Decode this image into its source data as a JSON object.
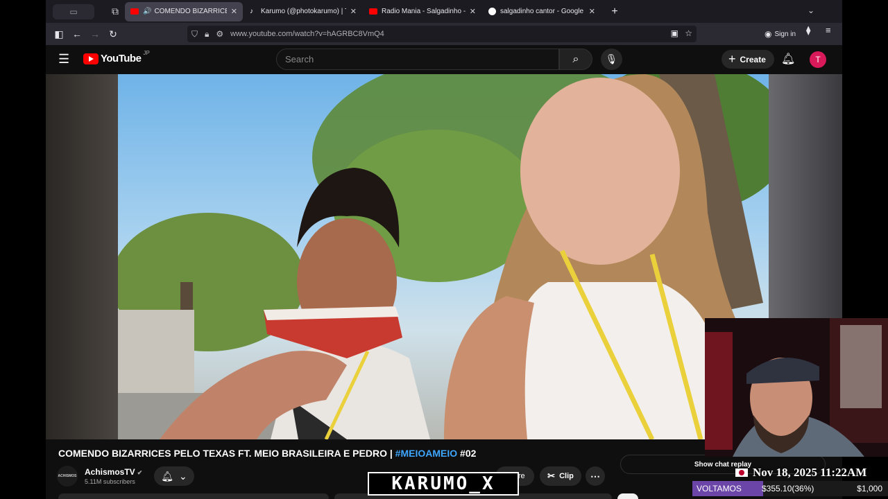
{
  "browser": {
    "tabs": [
      {
        "label": "COMENDO BIZARRICES PELO TEXAS",
        "favicon": "youtube-icon",
        "active": true,
        "audio": true
      },
      {
        "label": "Karumo (@photokarumo) | TikTok",
        "favicon": "tiktok-icon",
        "active": false
      },
      {
        "label": "Radio Mania - Salgadinho - Ainda",
        "favicon": "youtube-icon",
        "active": false
      },
      {
        "label": "salgadinho cantor - Google Search",
        "favicon": "google-icon",
        "active": false
      }
    ],
    "url": "www.youtube.com/watch?v=hAGRBC8VmQ4",
    "signin_label": "Sign in"
  },
  "youtube": {
    "logo_text": "YouTube",
    "region": "JP",
    "search_placeholder": "Search",
    "create_label": "Create",
    "avatar_letter": "T"
  },
  "video": {
    "title_main": "COMENDO BIZARRICES PELO TEXAS FT. MEIO BRASILEIRA E PEDRO | ",
    "title_hashtag": "#MEIOAMEIO",
    "title_suffix": " #02",
    "channel_name": "AchismosTV",
    "channel_avatar_text": "ACHISMOS",
    "subscribers": "5.11M subscribers",
    "share_label": "Share",
    "clip_label": "Clip",
    "chat_replay_label": "Show chat replay"
  },
  "overlay": {
    "datetime": "Nov 18, 2025 11:22AM",
    "goal_title": "VOLTAMOS",
    "goal_current": "$355.10(36%)",
    "goal_target": "$1,000",
    "goal_fraction": 0.36,
    "brand_text": "KARUMO_X"
  },
  "colors": {
    "youtube_red": "#ff0000",
    "hashtag_blue": "#3ea6ff",
    "avatar_pink": "#d8195a",
    "goal_purple": "#6b46a8"
  }
}
